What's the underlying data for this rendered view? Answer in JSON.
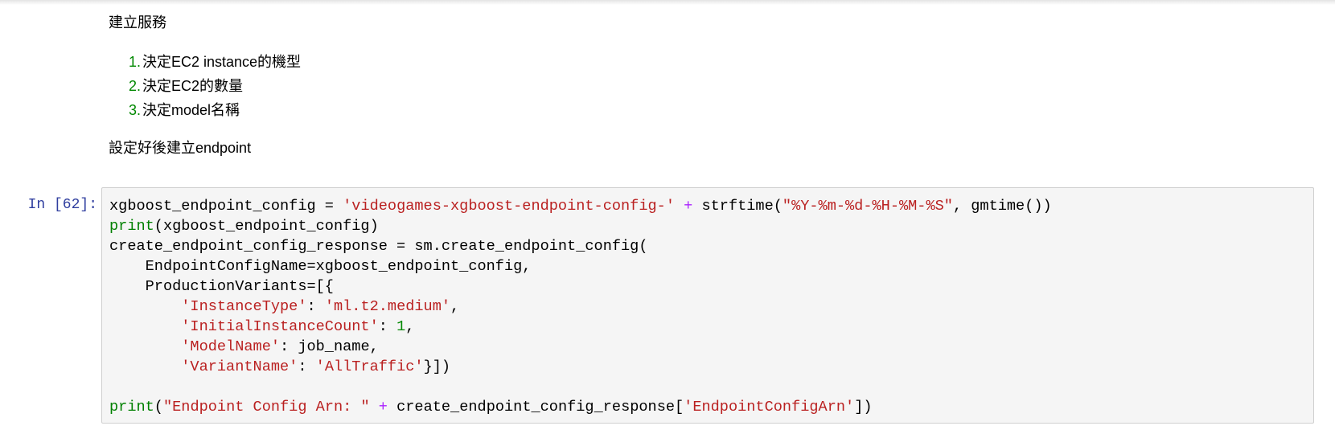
{
  "markdown": {
    "heading": "建立服務",
    "list": [
      {
        "num": "1.",
        "text": "決定EC2 instance的機型"
      },
      {
        "num": "2.",
        "text": "決定EC2的數量"
      },
      {
        "num": "3.",
        "text": "決定model名稱"
      }
    ],
    "after": "設定好後建立endpoint"
  },
  "code_cell": {
    "prompt": "In [62]:",
    "lines": [
      [
        {
          "t": "xgboost_endpoint_config = ",
          "c": ""
        },
        {
          "t": "'videogames-xgboost-endpoint-config-'",
          "c": "s"
        },
        {
          "t": " ",
          "c": ""
        },
        {
          "t": "+",
          "c": "op"
        },
        {
          "t": " strftime(",
          "c": ""
        },
        {
          "t": "\"%Y-%m-%d-%H-%M-%S\"",
          "c": "s"
        },
        {
          "t": ", gmtime())",
          "c": ""
        }
      ],
      [
        {
          "t": "print",
          "c": "kw"
        },
        {
          "t": "(xgboost_endpoint_config)",
          "c": ""
        }
      ],
      [
        {
          "t": "create_endpoint_config_response = sm.create_endpoint_config(",
          "c": ""
        }
      ],
      [
        {
          "t": "    EndpointConfigName=xgboost_endpoint_config,",
          "c": ""
        }
      ],
      [
        {
          "t": "    ProductionVariants=[{",
          "c": ""
        }
      ],
      [
        {
          "t": "        ",
          "c": ""
        },
        {
          "t": "'InstanceType'",
          "c": "s"
        },
        {
          "t": ": ",
          "c": ""
        },
        {
          "t": "'ml.t2.medium'",
          "c": "s"
        },
        {
          "t": ",",
          "c": ""
        }
      ],
      [
        {
          "t": "        ",
          "c": ""
        },
        {
          "t": "'InitialInstanceCount'",
          "c": "s"
        },
        {
          "t": ": ",
          "c": ""
        },
        {
          "t": "1",
          "c": "num"
        },
        {
          "t": ",",
          "c": ""
        }
      ],
      [
        {
          "t": "        ",
          "c": ""
        },
        {
          "t": "'ModelName'",
          "c": "s"
        },
        {
          "t": ": job_name,",
          "c": ""
        }
      ],
      [
        {
          "t": "        ",
          "c": ""
        },
        {
          "t": "'VariantName'",
          "c": "s"
        },
        {
          "t": ": ",
          "c": ""
        },
        {
          "t": "'AllTraffic'",
          "c": "s"
        },
        {
          "t": "}])",
          "c": ""
        }
      ],
      [],
      [
        {
          "t": "print",
          "c": "kw"
        },
        {
          "t": "(",
          "c": ""
        },
        {
          "t": "\"Endpoint Config Arn: \"",
          "c": "s"
        },
        {
          "t": " ",
          "c": ""
        },
        {
          "t": "+",
          "c": "op"
        },
        {
          "t": " create_endpoint_config_response[",
          "c": ""
        },
        {
          "t": "'EndpointConfigArn'",
          "c": "s"
        },
        {
          "t": "])",
          "c": ""
        }
      ]
    ]
  },
  "colors": {
    "prompt": "#303f9f",
    "string": "#ba2121",
    "operator": "#aa22ff",
    "number": "#008800",
    "builtin": "#008000",
    "cell_background": "#f5f5f5",
    "cell_border": "#cfcfcf"
  }
}
